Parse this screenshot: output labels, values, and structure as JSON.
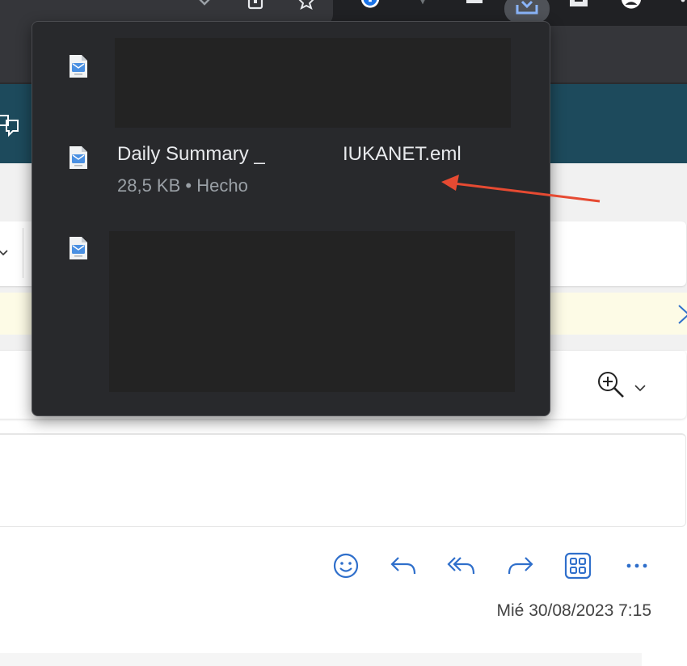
{
  "downloads": {
    "items": [
      {
        "filename_part1": "",
        "filename_part2": "",
        "status": "",
        "redacted": true
      },
      {
        "filename_part1": "Daily Summary _",
        "filename_part2": "IUKANET.eml",
        "status": "28,5 KB • Hecho",
        "redacted": false
      },
      {
        "filename_part1": "",
        "filename_part2": "",
        "status": "",
        "redacted": true
      }
    ]
  },
  "message": {
    "date": "Mié 30/08/2023 7:15"
  },
  "colors": {
    "panel_bg": "#28292c",
    "annotation_arrow": "#e64a32",
    "outlook_accent": "#2f6fcb",
    "header_teal": "#1d4a5c"
  }
}
